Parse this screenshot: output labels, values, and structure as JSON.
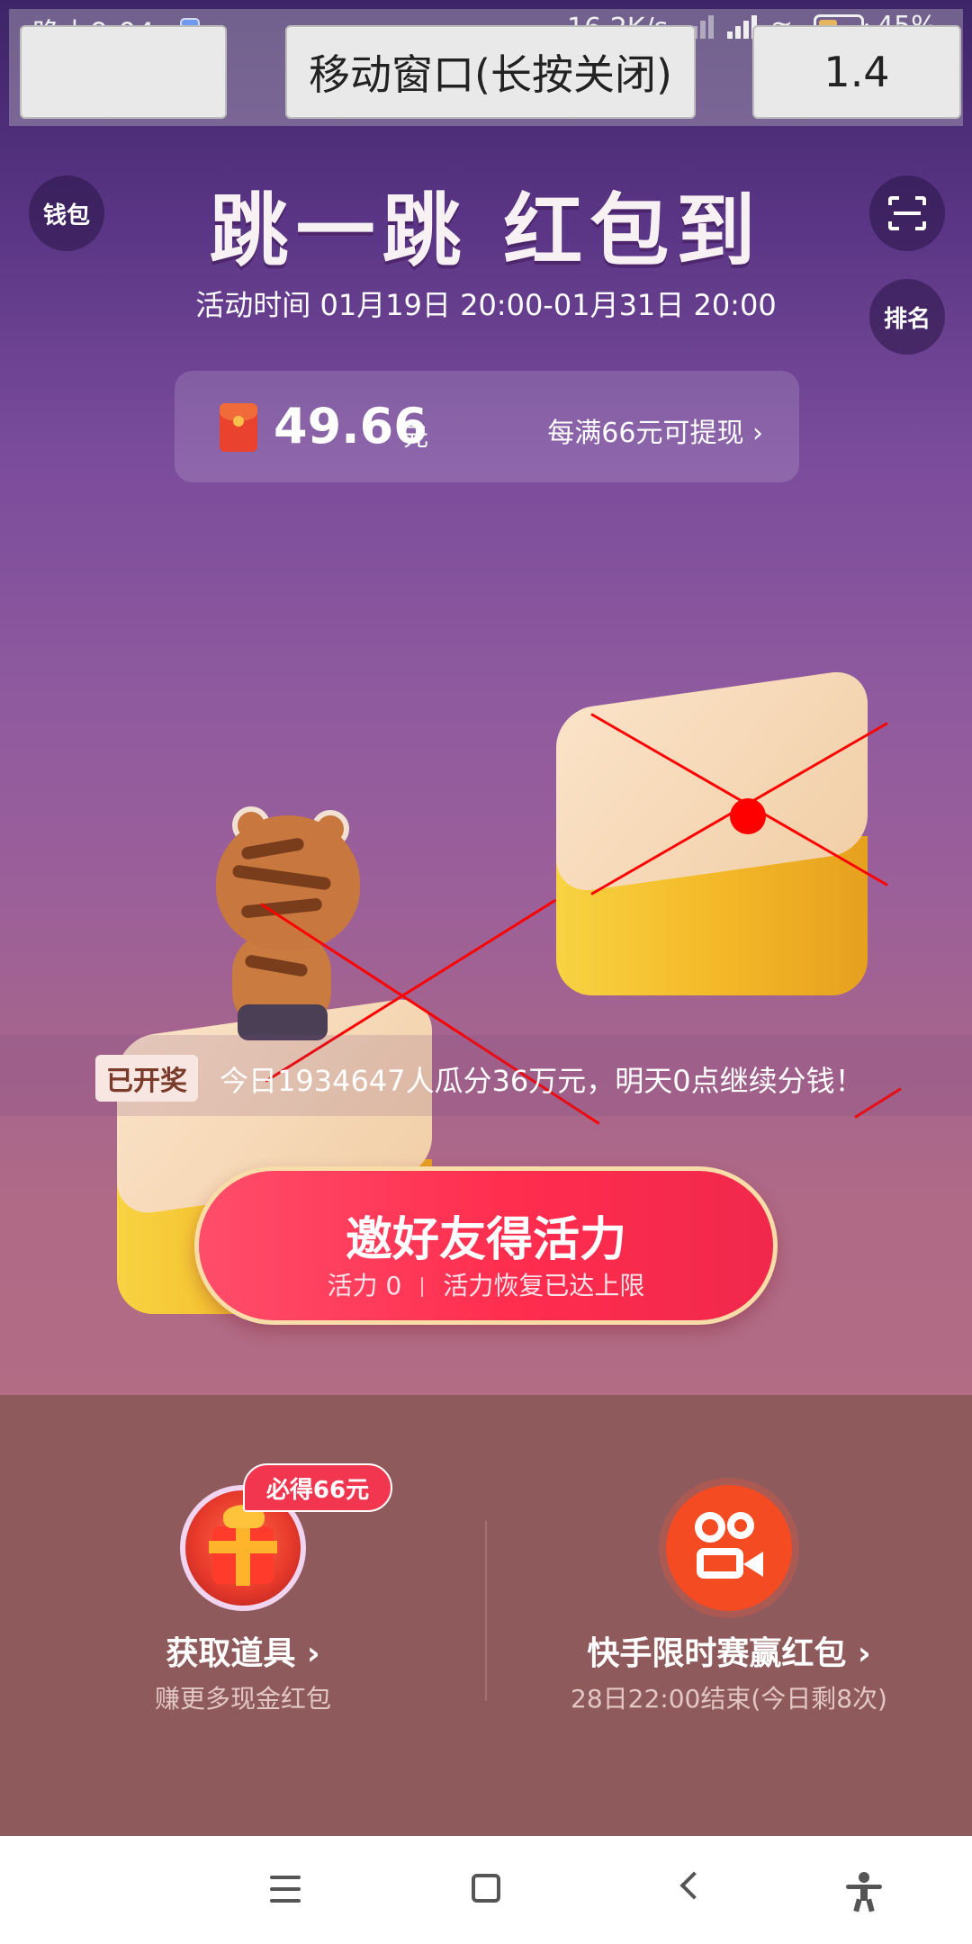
{
  "status_bar": {
    "time": "晚上9:04",
    "net_speed": "16.2K/s",
    "battery": "45%",
    "battery_level": 0.45
  },
  "overlay": {
    "move_window": "移动窗口(长按关闭)",
    "right_value": "1.4"
  },
  "header": {
    "wallet": "钱包",
    "rank": "排名",
    "title": "跳一跳 红包到",
    "activity_time": "活动时间 01月19日 20:00-01月31日 20:00"
  },
  "balance": {
    "amount": "49.66",
    "unit": "元",
    "withdraw_hint": "每满66元可提现 ›"
  },
  "prize": {
    "badge": "已开奖",
    "text": "今日1934647人瓜分36万元，明天0点继续分钱！"
  },
  "invite": {
    "title": "邀好友得活力",
    "energy": "活力 0",
    "recover": "活力恢复已达上限"
  },
  "tools": {
    "badge": "必得66元",
    "title": "获取道具 ›",
    "subtitle": "赚更多现金红包"
  },
  "ks_race": {
    "title": "快手限时赛赢红包 ›",
    "subtitle": "28日22:00结束(今日剩8次)"
  },
  "colors": {
    "accent_red": "#ff2d4e",
    "overlay_line": "#ff0000"
  }
}
